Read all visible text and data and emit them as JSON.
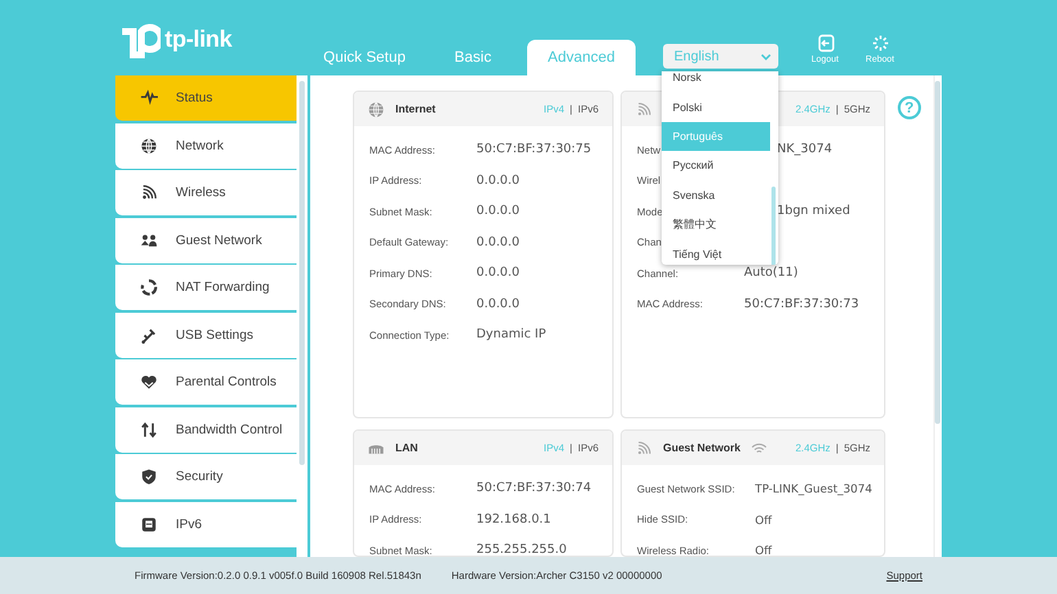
{
  "logo": {
    "text": "tp-link"
  },
  "tabs": [
    {
      "label": "Quick Setup",
      "selected": false
    },
    {
      "label": "Basic",
      "selected": false
    },
    {
      "label": "Advanced",
      "selected": true
    }
  ],
  "language_select": {
    "value": "English",
    "options": [
      {
        "label": "Norsk",
        "selected": false
      },
      {
        "label": "Polski",
        "selected": false
      },
      {
        "label": "Português",
        "selected": true
      },
      {
        "label": "Русский",
        "selected": false
      },
      {
        "label": "Svenska",
        "selected": false
      },
      {
        "label": "繁體中文",
        "selected": false
      },
      {
        "label": "Tiếng Việt",
        "selected": false
      }
    ]
  },
  "header_actions": [
    {
      "label": "Logout"
    },
    {
      "label": "Reboot"
    }
  ],
  "sidebar": {
    "items": [
      {
        "label": "Status",
        "selected": true
      },
      {
        "label": "Network",
        "selected": false
      },
      {
        "label": "Wireless",
        "selected": false
      },
      {
        "label": "Guest Network",
        "selected": false
      },
      {
        "label": "NAT Forwarding",
        "selected": false
      },
      {
        "label": "USB Settings",
        "selected": false
      },
      {
        "label": "Parental Controls",
        "selected": false
      },
      {
        "label": "Bandwidth Control",
        "selected": false
      },
      {
        "label": "Security",
        "selected": false
      },
      {
        "label": "IPv6",
        "selected": false
      }
    ]
  },
  "help": "?",
  "cards": [
    {
      "title": "Internet",
      "separator": "|",
      "switch": [
        {
          "label": "IPv4",
          "selected": true
        },
        {
          "label": "IPv6",
          "selected": false
        }
      ],
      "rows": [
        {
          "label": "MAC Address:",
          "value": "50:C7:BF:37:30:75"
        },
        {
          "label": "IP Address:",
          "value": "0.0.0.0"
        },
        {
          "label": "Subnet Mask:",
          "value": "0.0.0.0"
        },
        {
          "label": "Default Gateway:",
          "value": "0.0.0.0"
        },
        {
          "label": "Primary DNS:",
          "value": "0.0.0.0"
        },
        {
          "label": "Secondary DNS:",
          "value": "0.0.0.0"
        },
        {
          "label": "Connection Type:",
          "value": "Dynamic IP"
        }
      ]
    },
    {
      "separator": "|",
      "switch": [
        {
          "label": "2.4GHz",
          "selected": true
        },
        {
          "label": "5GHz",
          "selected": false
        }
      ],
      "rows": [
        {
          "label": "Netw",
          "value": "NK_3074",
          "partly_hidden": true
        },
        {
          "label": "Wirel"
        },
        {
          "label": "Mode",
          "value": "1bgn mixed",
          "partly_hidden": true
        },
        {
          "label": "Chan"
        },
        {
          "label": "Channel:",
          "value": "Auto(11)",
          "partly_hidden": false
        },
        {
          "label": "MAC Address:",
          "value": "50:C7:BF:37:30:73",
          "partly_hidden": false
        }
      ]
    },
    {
      "title": "LAN",
      "separator": "|",
      "switch": [
        {
          "label": "IPv4",
          "selected": true
        },
        {
          "label": "IPv6",
          "selected": false
        }
      ],
      "rows": [
        {
          "label": "MAC Address:",
          "value": "50:C7:BF:37:30:74"
        },
        {
          "label": "IP Address:",
          "value": "192.168.0.1"
        },
        {
          "label": "Subnet Mask:",
          "value": "255.255.255.0"
        }
      ]
    },
    {
      "title": "Guest Network",
      "separator": "|",
      "switch": [
        {
          "label": "2.4GHz",
          "selected": true
        },
        {
          "label": "5GHz",
          "selected": false
        }
      ],
      "rows": [
        {
          "label": "Guest Network SSID:",
          "value": "TP-LINK_Guest_3074"
        },
        {
          "label": "Hide SSID:",
          "value": "Off"
        },
        {
          "label": "Wireless Radio:",
          "value": "Off"
        }
      ]
    }
  ],
  "footer": {
    "firmware": "Firmware Version:0.2.0 0.9.1 v005f.0 Build 160908 Rel.51843n",
    "hardware": "Hardware Version:Archer C3150 v2 00000000",
    "support": "Support"
  }
}
